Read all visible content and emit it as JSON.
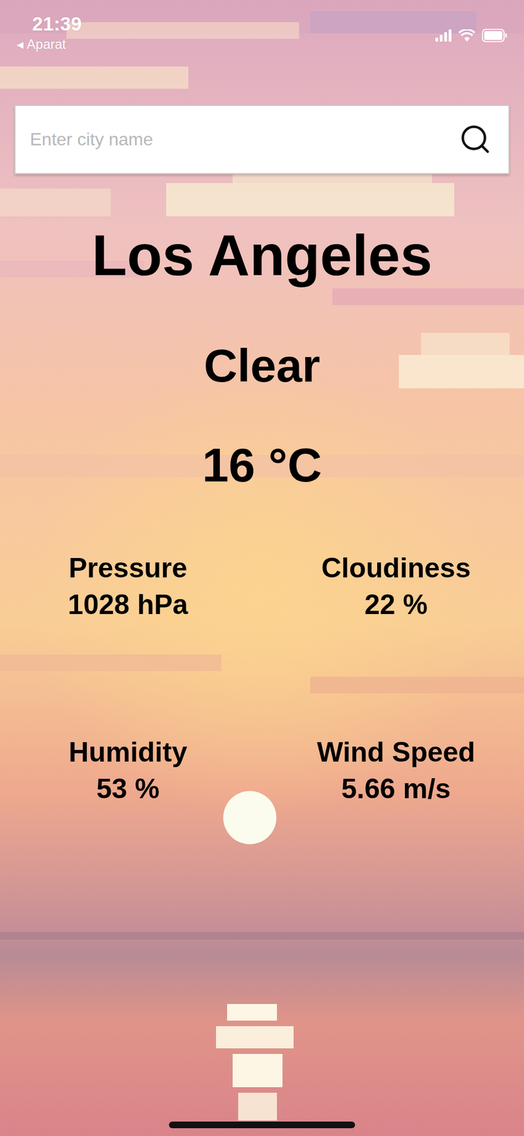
{
  "status_bar": {
    "time": "21:39",
    "back": {
      "icon": "◀",
      "label": "Aparat"
    }
  },
  "search": {
    "placeholder": "Enter city name"
  },
  "weather": {
    "city": "Los Angeles",
    "condition": "Clear",
    "temperature": "16 °C"
  },
  "stats": [
    {
      "label": "Pressure",
      "value": "1028 hPa"
    },
    {
      "label": "Cloudiness",
      "value": "22 %"
    },
    {
      "label": "Humidity",
      "value": "53 %"
    },
    {
      "label": "Wind Speed",
      "value": "5.66 m/s"
    }
  ]
}
